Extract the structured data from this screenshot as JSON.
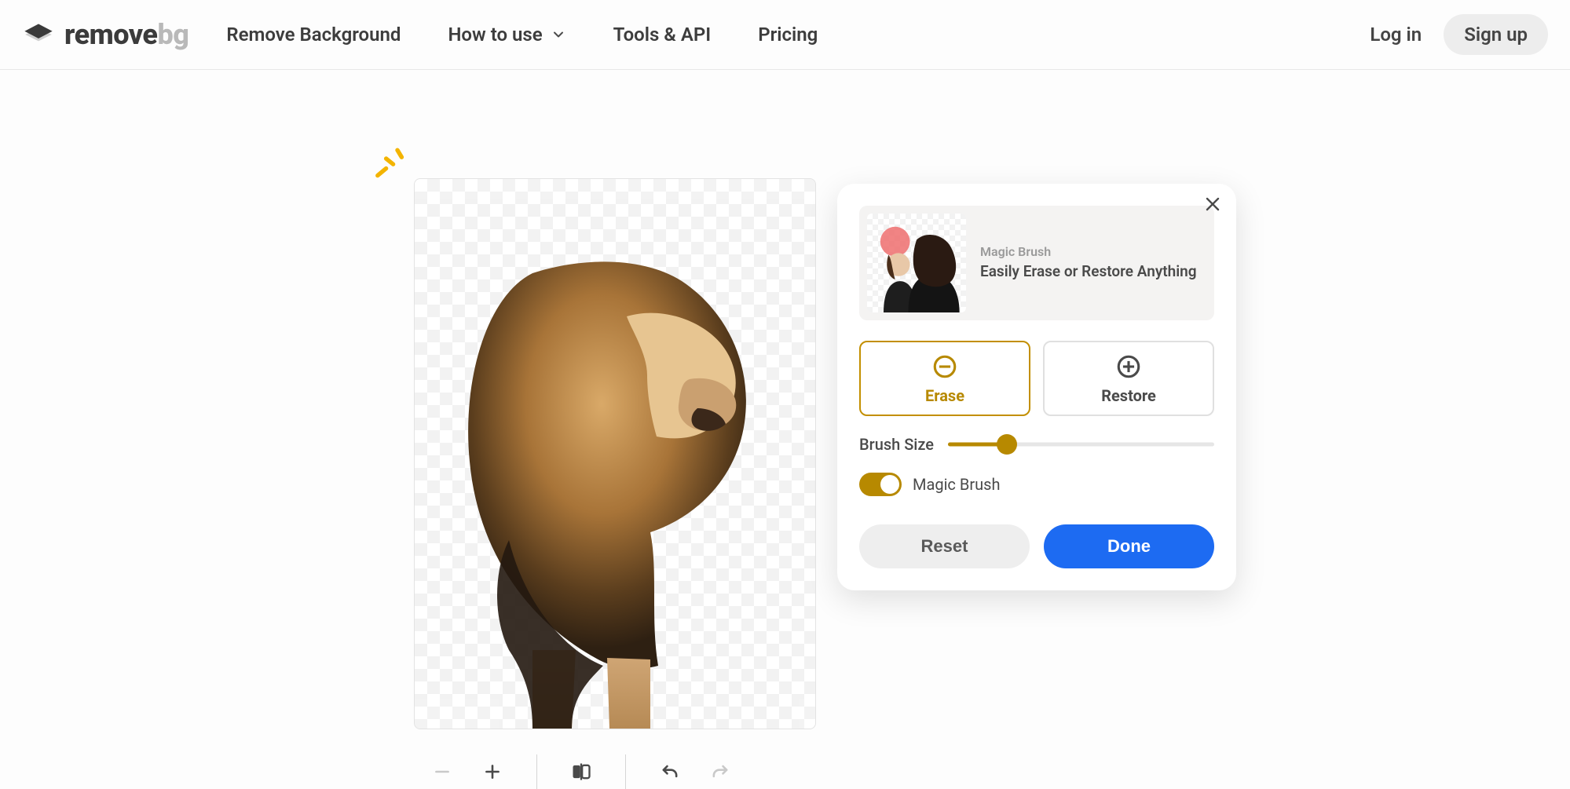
{
  "brand": {
    "name": "remove",
    "suffix": "bg"
  },
  "nav": {
    "remove_bg": "Remove Background",
    "how_to_use": "How to use",
    "tools_api": "Tools & API",
    "pricing": "Pricing"
  },
  "auth": {
    "login": "Log in",
    "signup": "Sign up"
  },
  "canvas": {
    "subject": "lion with transparent background"
  },
  "toolbar": {
    "zoom_out": "Zoom out",
    "zoom_in": "Zoom in",
    "compare": "Compare original",
    "undo": "Undo",
    "redo": "Redo"
  },
  "panel": {
    "close": "Close",
    "magic_brush": {
      "title": "Magic Brush",
      "subtitle": "Easily Erase or Restore Anything"
    },
    "modes": {
      "erase": "Erase",
      "restore": "Restore",
      "active": "erase"
    },
    "brush": {
      "label": "Brush Size",
      "value": 22
    },
    "toggle": {
      "label": "Magic Brush",
      "on": true
    },
    "actions": {
      "reset": "Reset",
      "done": "Done"
    }
  }
}
